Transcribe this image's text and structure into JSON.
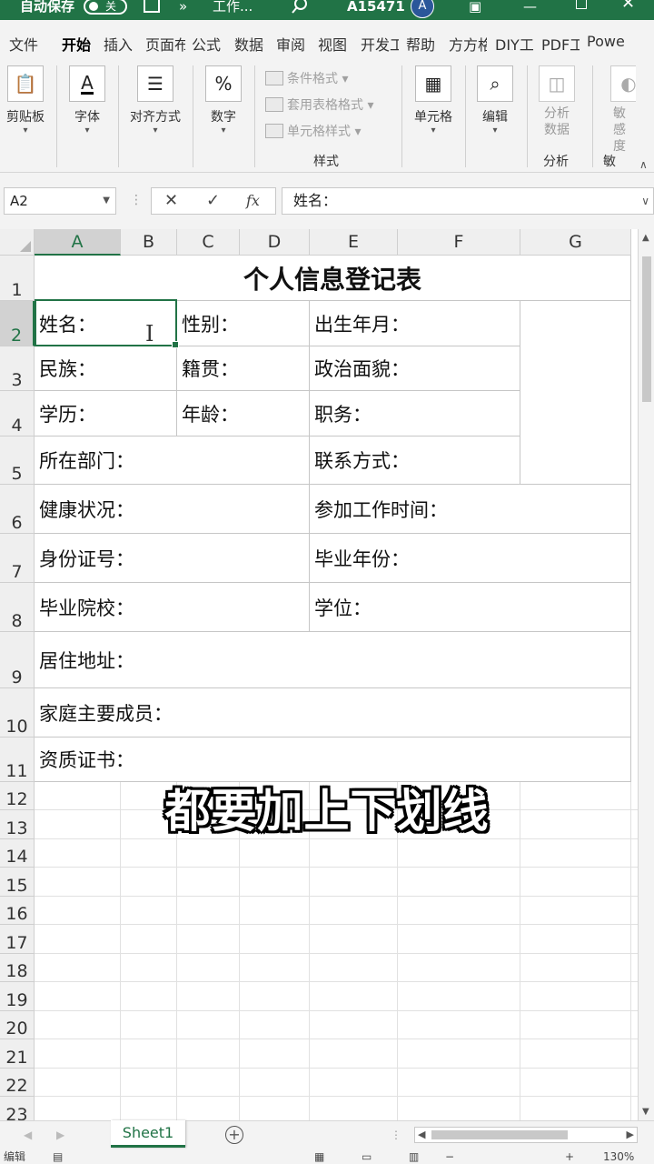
{
  "titlebar": {
    "autosave_label": "自动保存",
    "autosave_state": "关",
    "doc_name": "工作...",
    "more": "»",
    "user_name": "A15471",
    "avatar_letter": "A"
  },
  "tabs": [
    "文件",
    "开始",
    "插入",
    "页面布",
    "公式",
    "数据",
    "审阅",
    "视图",
    "开发工",
    "帮助",
    "方方格",
    "DIY工",
    "PDF工",
    "Powe"
  ],
  "active_tab": "开始",
  "ribbon": {
    "clipboard": "剪贴板",
    "font": "字体",
    "alignment": "对齐方式",
    "number": "数字",
    "number_symbol": "%",
    "conditional_format": "条件格式",
    "table_format": "套用表格格式",
    "cell_styles": "单元格样式",
    "styles_group": "样式",
    "cells": "单元格",
    "editing": "编辑",
    "analyze_data": "分析数据",
    "analysis_group": "分析",
    "sensitivity": "敏感度",
    "sensitivity_caption": "敏"
  },
  "formula_bar": {
    "name_box": "A2",
    "cancel": "✕",
    "enter": "✓",
    "fx": "fx",
    "content": "姓名："
  },
  "columns": [
    "A",
    "B",
    "C",
    "D",
    "E",
    "F",
    "G"
  ],
  "rows": [
    "1",
    "2",
    "3",
    "4",
    "5",
    "6",
    "7",
    "8",
    "9",
    "10",
    "11",
    "12",
    "13",
    "14",
    "15",
    "16",
    "17",
    "18",
    "19",
    "20",
    "21",
    "22",
    "23"
  ],
  "sheet": {
    "title": "个人信息登记表",
    "r2": {
      "ab": "姓名：",
      "cd": "性别：",
      "ef": "出生年月："
    },
    "r3": {
      "ab": "民族：",
      "cd": "籍贯：",
      "ef": "政治面貌："
    },
    "r4": {
      "ab": "学历：",
      "cd": "年龄：",
      "ef": "职务："
    },
    "r5": {
      "ad": "所在部门：",
      "ef": "联系方式："
    },
    "r6": {
      "ad": "健康状况：",
      "eg": "参加工作时间："
    },
    "r7": {
      "ad": "身份证号：",
      "eg": "毕业年份："
    },
    "r8": {
      "ad": "毕业院校：",
      "eg": "学位："
    },
    "r9": {
      "ag": "居住地址："
    },
    "r10": {
      "ag": "家庭主要成员："
    },
    "r11": {
      "ag": "资质证书："
    }
  },
  "subtitle": "都要加上下划线",
  "sheet_tab": "Sheet1",
  "add_sheet": "+",
  "status": {
    "mode": "编辑",
    "zoom": "130%"
  }
}
